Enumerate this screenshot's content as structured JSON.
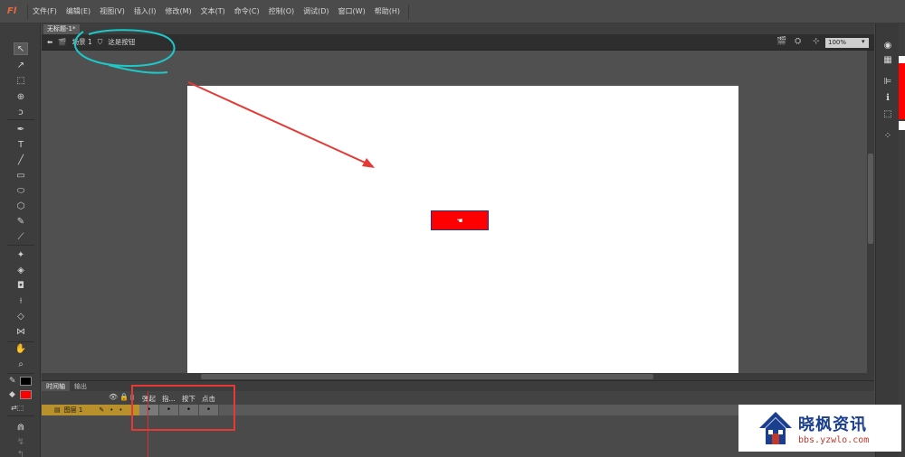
{
  "app": {
    "logo": "Fl"
  },
  "menu": [
    "文件(F)",
    "编辑(E)",
    "视图(V)",
    "插入(I)",
    "修改(M)",
    "文本(T)",
    "命令(C)",
    "控制(O)",
    "调试(D)",
    "窗口(W)",
    "帮助(H)"
  ],
  "document": {
    "tab_title": "无标题-1*"
  },
  "editbar": {
    "scene": "场景 1",
    "symbol": "这是按钮",
    "zoom": "100%"
  },
  "timeline": {
    "tabs": [
      "时间轴",
      "输出"
    ],
    "layer_name": "图层 1",
    "frame_labels": [
      "弹起",
      "指...",
      "按下",
      "点击"
    ],
    "frame_markers": [
      "•",
      "•",
      "•",
      "•"
    ]
  },
  "stage": {
    "background": "#ffffff",
    "button_color": "#ff0000",
    "button_cursor": "☚"
  },
  "toolbar_icons": [
    "selection-tool",
    "subselection-tool",
    "free-transform-tool",
    "3d-rotation-tool",
    "lasso-tool",
    "pen-tool",
    "text-tool",
    "line-tool",
    "rectangle-tool",
    "oval-tool",
    "polystar-tool",
    "pencil-tool",
    "brush-tool",
    "bone-tool",
    "paint-bucket-tool",
    "eyedropper-tool",
    "eraser-tool",
    "width-tool",
    "hand-tool",
    "zoom-tool"
  ],
  "colors": {
    "stroke": "#000000",
    "fill": "#ff0000",
    "annotation_circle": "#1ec8c8",
    "annotation_box": "#e53935",
    "annotation_arrow": "#e53935"
  },
  "watermark": {
    "title": "晓枫资讯",
    "url": "bbs.yzwlo.com"
  }
}
